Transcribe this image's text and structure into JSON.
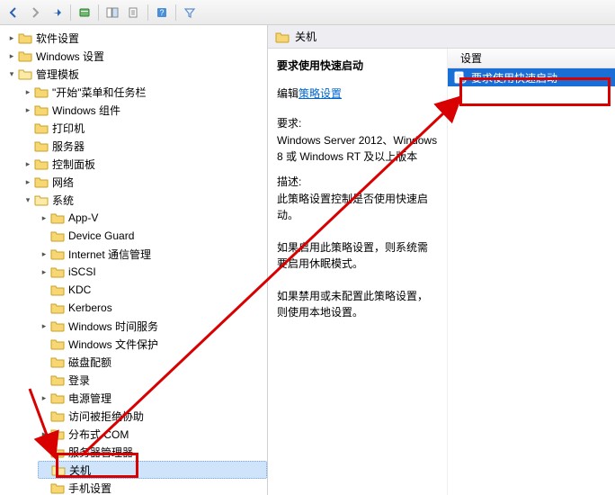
{
  "toolbar": {
    "icons": [
      "back",
      "forward",
      "up",
      "app",
      "home",
      "grid",
      "list",
      "help",
      "filter"
    ]
  },
  "tree": [
    {
      "label": "软件设置",
      "twisty": "closed"
    },
    {
      "label": "Windows 设置",
      "twisty": "closed"
    },
    {
      "label": "管理模板",
      "twisty": "open",
      "children": [
        {
          "label": "\"开始\"菜单和任务栏",
          "twisty": "closed"
        },
        {
          "label": "Windows 组件",
          "twisty": "closed"
        },
        {
          "label": "打印机",
          "twisty": "none"
        },
        {
          "label": "服务器",
          "twisty": "none"
        },
        {
          "label": "控制面板",
          "twisty": "closed"
        },
        {
          "label": "网络",
          "twisty": "closed"
        },
        {
          "label": "系统",
          "twisty": "open",
          "children": [
            {
              "label": "App-V",
              "twisty": "closed"
            },
            {
              "label": "Device Guard",
              "twisty": "none"
            },
            {
              "label": "Internet 通信管理",
              "twisty": "closed"
            },
            {
              "label": "iSCSI",
              "twisty": "closed"
            },
            {
              "label": "KDC",
              "twisty": "none"
            },
            {
              "label": "Kerberos",
              "twisty": "none"
            },
            {
              "label": "Windows 时间服务",
              "twisty": "closed"
            },
            {
              "label": "Windows 文件保护",
              "twisty": "none"
            },
            {
              "label": "磁盘配额",
              "twisty": "none"
            },
            {
              "label": "登录",
              "twisty": "none"
            },
            {
              "label": "电源管理",
              "twisty": "closed"
            },
            {
              "label": "访问被拒绝协助",
              "twisty": "none"
            },
            {
              "label": "分布式 COM",
              "twisty": "closed"
            },
            {
              "label": "服务器管理器",
              "twisty": "none"
            },
            {
              "label": "关机",
              "twisty": "none",
              "selected": true
            },
            {
              "label": "手机设置",
              "twisty": "none"
            }
          ]
        }
      ]
    }
  ],
  "detail": {
    "header_title": "关机",
    "policy_title": "要求使用快速启动",
    "edit_prefix": "编辑",
    "edit_link": "策略设置",
    "req_label": "要求:",
    "req_body": "Windows Server 2012、Windows 8 或 Windows RT 及以上版本",
    "desc_label": "描述:",
    "desc_body": "此策略设置控制是否使用快速启动。\n\n如果启用此策略设置，则系统需要启用休眠模式。\n\n如果禁用或未配置此策略设置，则使用本地设置。",
    "column_header": "设置",
    "items": [
      {
        "label": "要求使用快速启动",
        "selected": true
      }
    ]
  }
}
